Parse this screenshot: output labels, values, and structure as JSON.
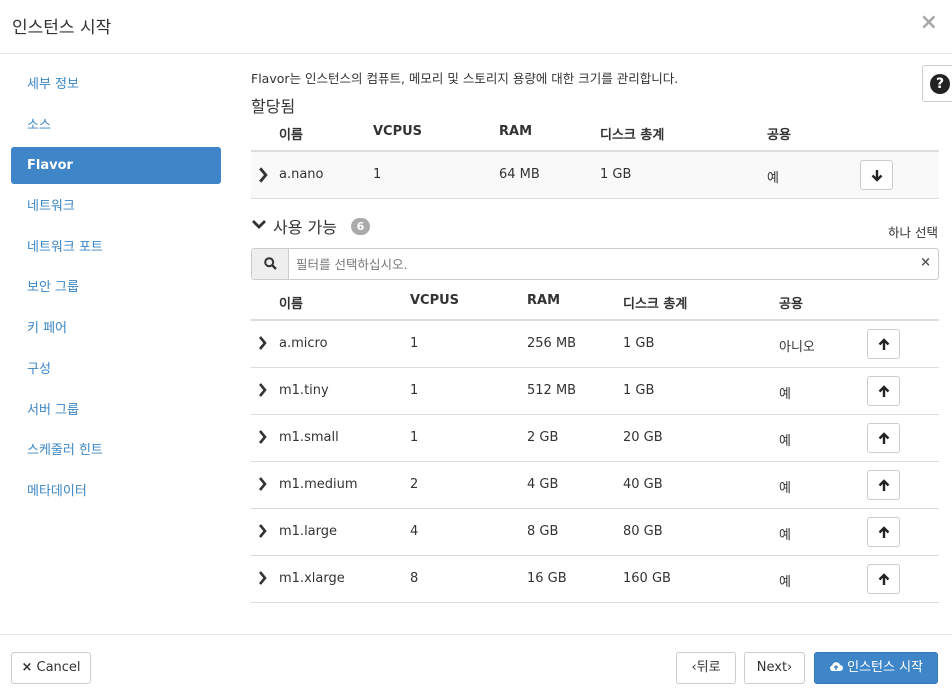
{
  "header": {
    "title": "인스턴스 시작",
    "close_glyph": "×"
  },
  "sidebar": {
    "items": [
      {
        "label": "세부 정보"
      },
      {
        "label": "소스"
      },
      {
        "label": "Flavor",
        "active": true
      },
      {
        "label": "네트워크"
      },
      {
        "label": "네트워크 포트"
      },
      {
        "label": "보안 그룹"
      },
      {
        "label": "키 페어"
      },
      {
        "label": "구성"
      },
      {
        "label": "서버 그룹"
      },
      {
        "label": "스케줄러 힌트"
      },
      {
        "label": "메타데이터"
      }
    ]
  },
  "help": {
    "glyph": "?"
  },
  "main": {
    "description": "Flavor는 인스턴스의 컴퓨트, 메모리 및 스토리지 용량에 대한 크기를 관리합니다.",
    "allocated": {
      "title": "할당됨",
      "columns": [
        "이름",
        "VCPUS",
        "RAM",
        "디스크 총계",
        "공용"
      ],
      "rows": [
        {
          "name": "a.nano",
          "vcpus": "1",
          "ram": "64 MB",
          "disk": "1 GB",
          "public": "예"
        }
      ]
    },
    "available": {
      "title": "사용 가능",
      "count": "6",
      "select_one": "하나 선택",
      "filter_placeholder": "필터를 선택하십시오.",
      "columns": [
        "이름",
        "VCPUS",
        "RAM",
        "디스크 총계",
        "공용"
      ],
      "rows": [
        {
          "name": "a.micro",
          "vcpus": "1",
          "ram": "256 MB",
          "disk": "1 GB",
          "public": "아니오"
        },
        {
          "name": "m1.tiny",
          "vcpus": "1",
          "ram": "512 MB",
          "disk": "1 GB",
          "public": "예"
        },
        {
          "name": "m1.small",
          "vcpus": "1",
          "ram": "2 GB",
          "disk": "20 GB",
          "public": "예"
        },
        {
          "name": "m1.medium",
          "vcpus": "2",
          "ram": "4 GB",
          "disk": "40 GB",
          "public": "예"
        },
        {
          "name": "m1.large",
          "vcpus": "4",
          "ram": "8 GB",
          "disk": "80 GB",
          "public": "예"
        },
        {
          "name": "m1.xlarge",
          "vcpus": "8",
          "ram": "16 GB",
          "disk": "160 GB",
          "public": "예"
        }
      ]
    }
  },
  "footer": {
    "cancel": "Cancel",
    "cancel_icon": "×",
    "back": "뒤로",
    "next": "Next",
    "launch": "인스턴스 시작",
    "back_icon": "‹",
    "next_icon": "›"
  },
  "colors": {
    "accent": "#3e86c8",
    "link": "#3b86c5",
    "badge": "#aaaaaa"
  }
}
